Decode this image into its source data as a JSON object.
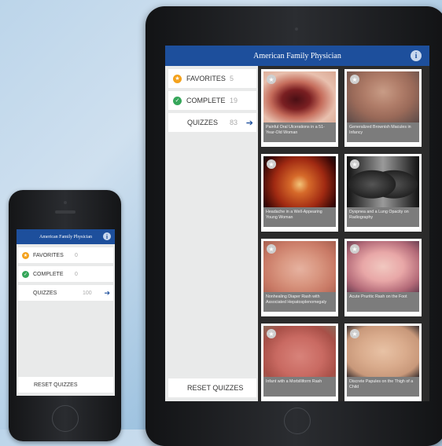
{
  "app_title": "American Family Physician",
  "phone": {
    "menu": [
      {
        "label": "FAVORITES",
        "count": "0",
        "icon": "star-icon",
        "color": "#f4a21d"
      },
      {
        "label": "COMPLETE",
        "count": "0",
        "icon": "check-icon",
        "color": "#36a65a"
      },
      {
        "label": "QUIZZES",
        "count": "100",
        "icon": "arrow-right-icon"
      }
    ],
    "reset_label": "RESET QUIZZES"
  },
  "tablet": {
    "menu": [
      {
        "label": "FAVORITES",
        "count": "5",
        "icon": "star-icon",
        "color": "#f4a21d"
      },
      {
        "label": "COMPLETE",
        "count": "19",
        "icon": "check-icon",
        "color": "#36a65a"
      },
      {
        "label": "QUIZZES",
        "count": "83",
        "icon": "arrow-right-icon"
      }
    ],
    "reset_label": "RESET QUIZZES",
    "quizzes": [
      {
        "caption": "Painful Oral Ulcerations in a 51-Year-Old Woman"
      },
      {
        "caption": "Generalized Brownish Macules in Infancy"
      },
      {
        "caption": "Headache in a Well-Appearing Young Woman"
      },
      {
        "caption": "Dyspnea and a Lung Opacity on Radiography"
      },
      {
        "caption": "Nonhealing Diaper Rash with Associated Hepatosplenomegaly"
      },
      {
        "caption": "Acute Pruritic Rash on the Foot"
      },
      {
        "caption": "Infant with a Morbilliform Rash"
      },
      {
        "caption": "Discrete Papules on the Thigh of a Child"
      }
    ]
  },
  "colors": {
    "header": "#1d4f9c",
    "favorites": "#f4a21d",
    "complete": "#36a65a"
  }
}
